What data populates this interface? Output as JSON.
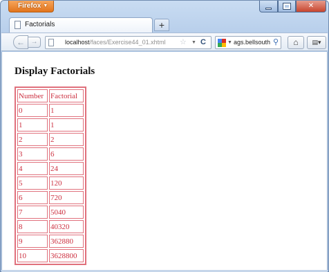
{
  "browser": {
    "menu_button_label": "Firefox",
    "tab": {
      "title": "Factorials"
    },
    "new_tab_label": "+",
    "address": {
      "host": "localhost",
      "path": "/faces/Exercise44_01.xhtml"
    },
    "search": {
      "value": "ags.bellsouth"
    },
    "icons": [
      "firefox-menu-chevron-icon",
      "minimize-icon",
      "maximize-icon",
      "close-icon",
      "page-icon",
      "back-arrow-icon",
      "forward-arrow-icon",
      "bookmark-star-icon",
      "dropdown-icon",
      "reload-icon",
      "search-engine-icon",
      "magnifier-icon",
      "home-icon",
      "menu-icon"
    ]
  },
  "page": {
    "title": "Display Factorials",
    "table": {
      "headers": [
        "Number",
        "Factorial"
      ],
      "rows": [
        [
          "0",
          "1"
        ],
        [
          "1",
          "1"
        ],
        [
          "2",
          "2"
        ],
        [
          "3",
          "6"
        ],
        [
          "4",
          "24"
        ],
        [
          "5",
          "120"
        ],
        [
          "6",
          "720"
        ],
        [
          "7",
          "5040"
        ],
        [
          "8",
          "40320"
        ],
        [
          "9",
          "362880"
        ],
        [
          "10",
          "3628800"
        ]
      ]
    },
    "colors": {
      "table_text": "#cc2f3f",
      "table_border": "#e0707c"
    }
  }
}
